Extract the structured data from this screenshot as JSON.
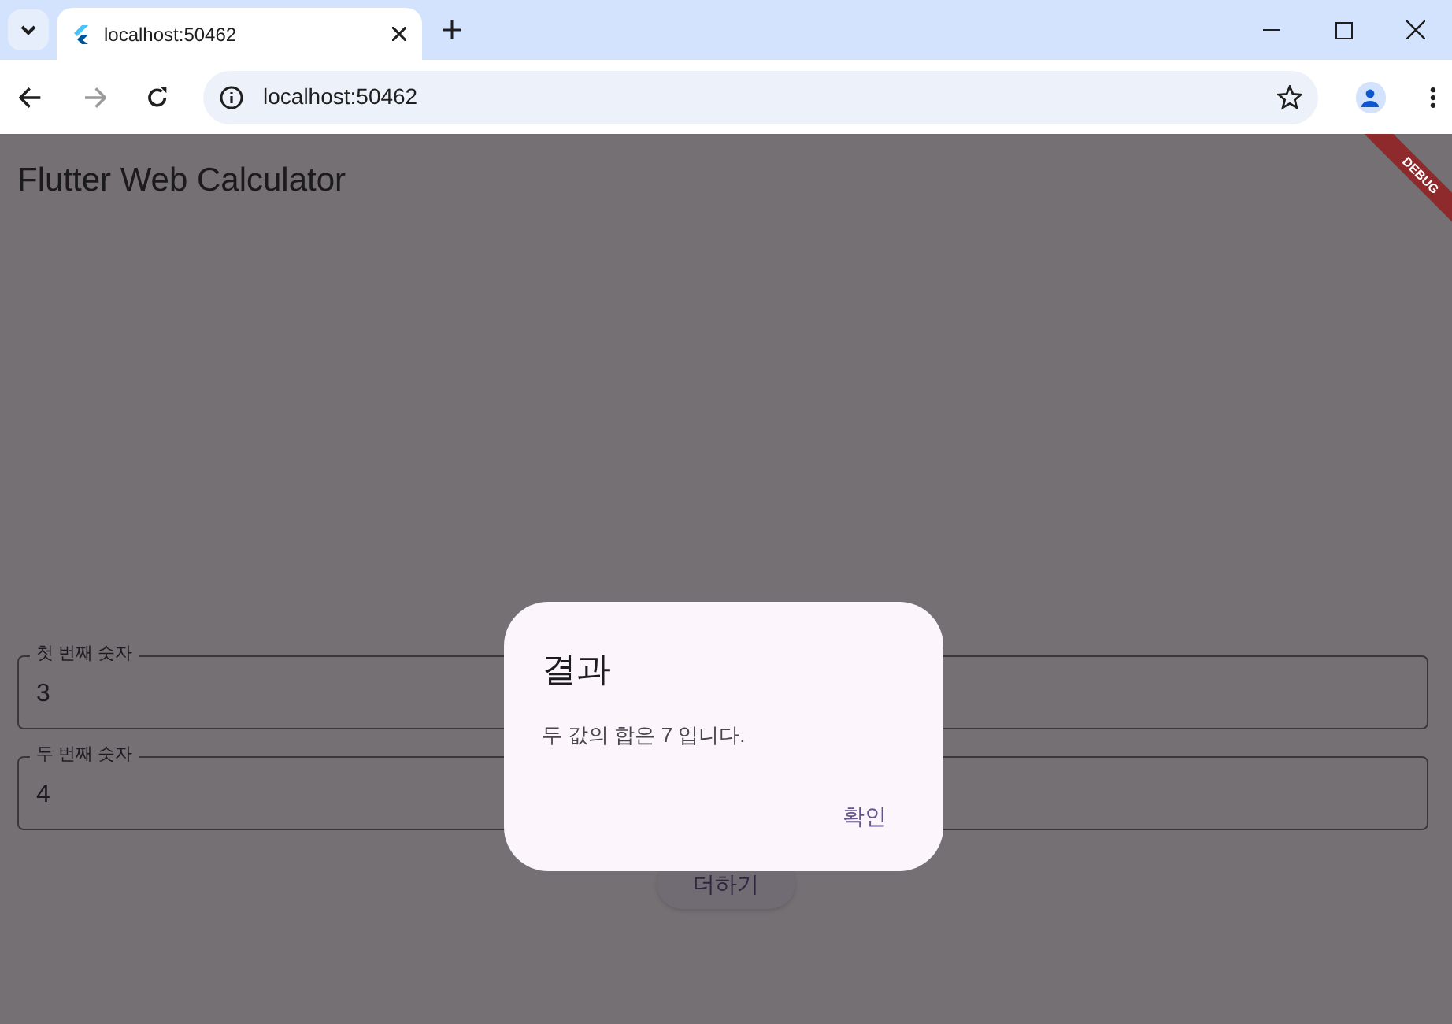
{
  "browser": {
    "tabs": [
      {
        "title": "localhost:50462",
        "selected": true
      }
    ],
    "address": "localhost:50462"
  },
  "app": {
    "title": "Flutter Web Calculator",
    "debug_banner": "DEBUG",
    "fields": [
      {
        "label": "첫 번째 숫자",
        "value": "3"
      },
      {
        "label": "두 번째 숫자",
        "value": "4"
      }
    ],
    "button": "더하기"
  },
  "dialog": {
    "title": "결과",
    "message": "두 값의 합은 7 입니다.",
    "actions": [
      "확인"
    ]
  }
}
